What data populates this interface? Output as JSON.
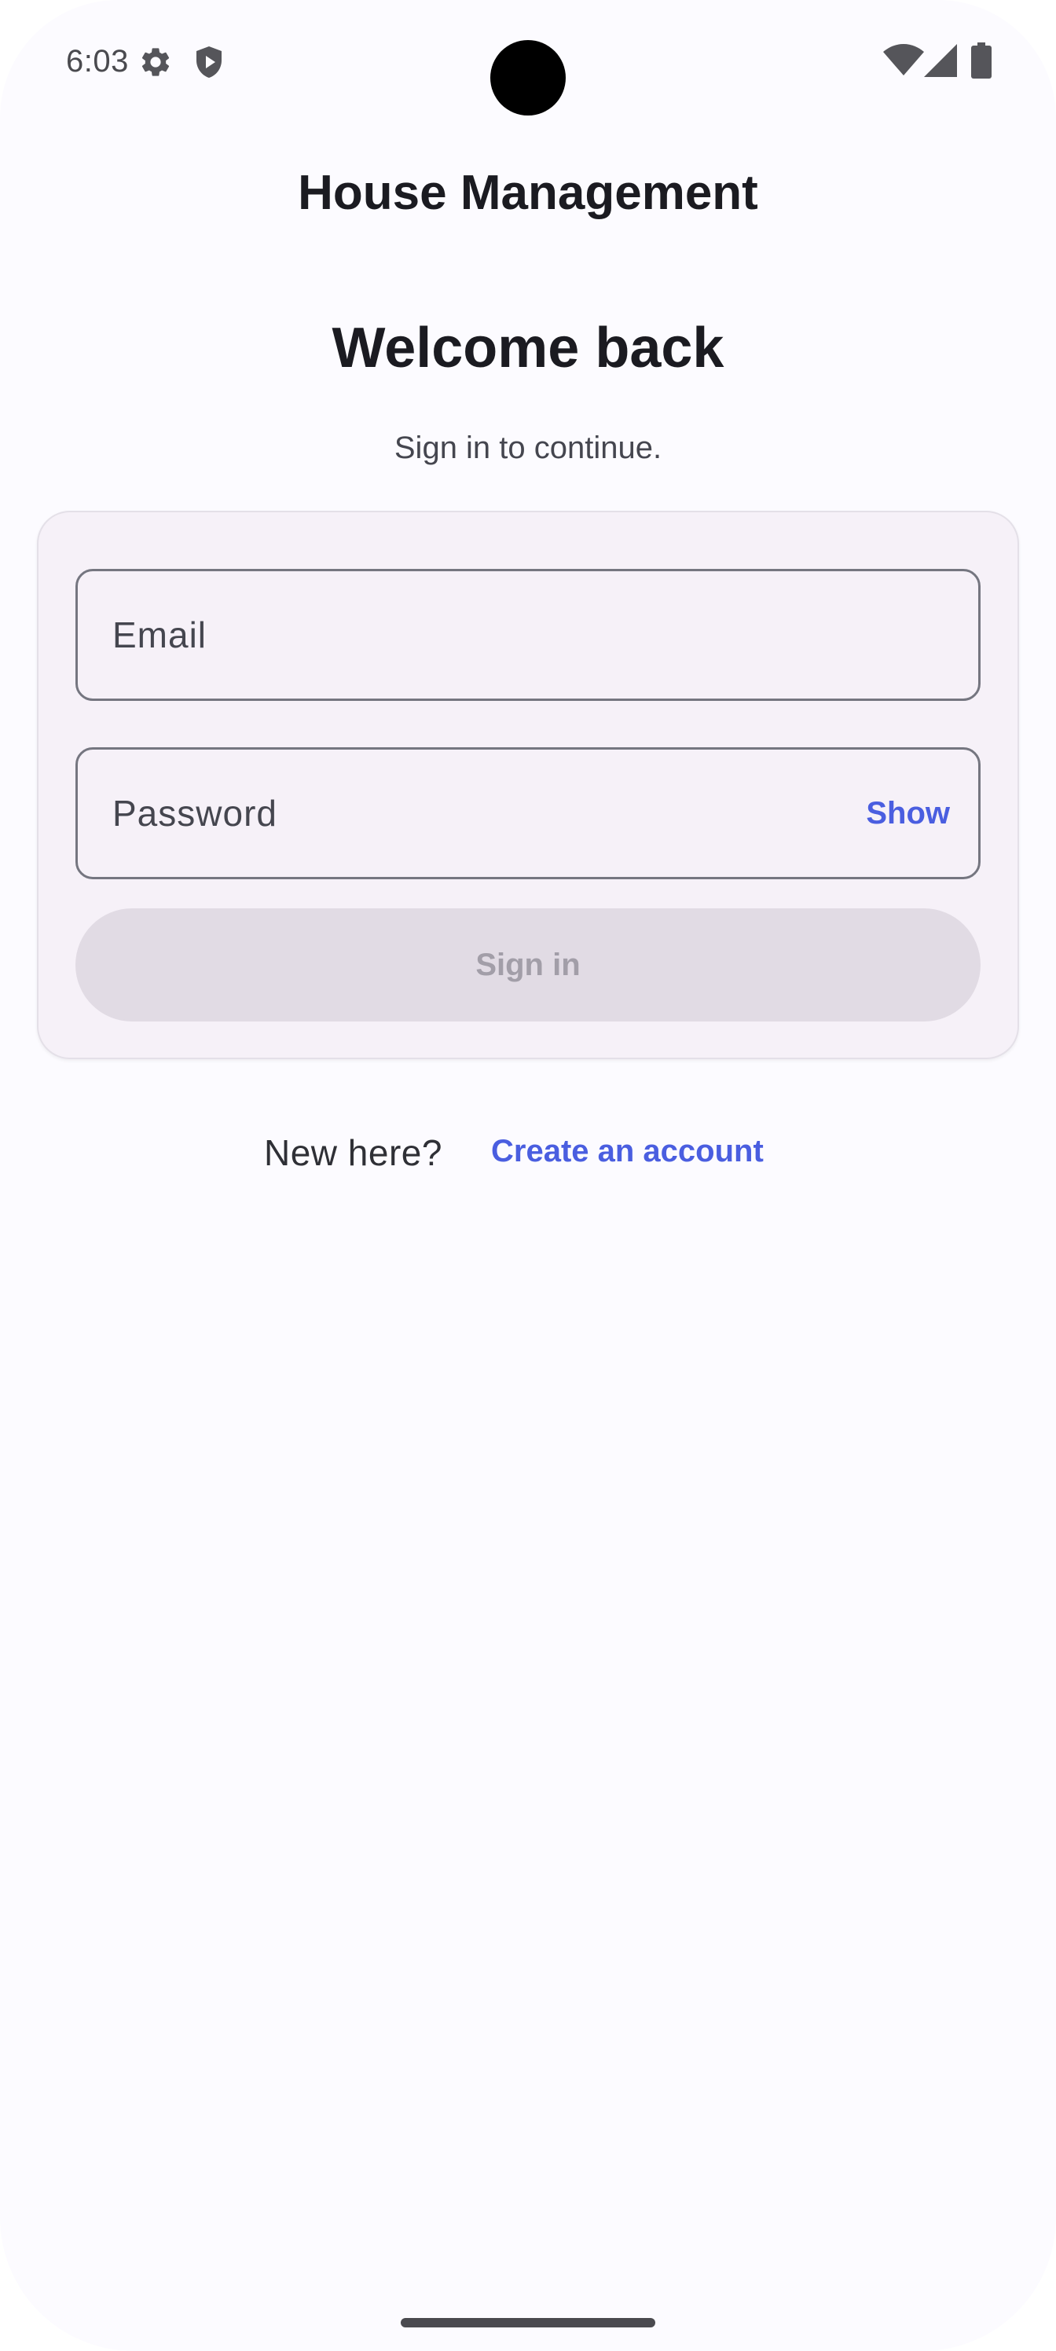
{
  "status_bar": {
    "time": "6:03",
    "icons": [
      "gear-icon",
      "shield-icon",
      "wifi-icon",
      "signal-icon",
      "battery-icon"
    ]
  },
  "header": {
    "app_title": "House Management"
  },
  "welcome": {
    "title": "Welcome back",
    "subtitle": "Sign in to continue."
  },
  "form": {
    "email": {
      "placeholder": "Email",
      "value": ""
    },
    "password": {
      "placeholder": "Password",
      "value": "",
      "toggle_label": "Show"
    },
    "signin_label": "Sign in",
    "signin_enabled": false
  },
  "footer": {
    "prompt": "New here?",
    "link_label": "Create an account"
  },
  "colors": {
    "accent": "#4a5ee0",
    "background": "#fcfbff",
    "card": "#f6f1f8",
    "button_disabled": "#e1dbe4",
    "text_primary": "#1b1b21"
  }
}
